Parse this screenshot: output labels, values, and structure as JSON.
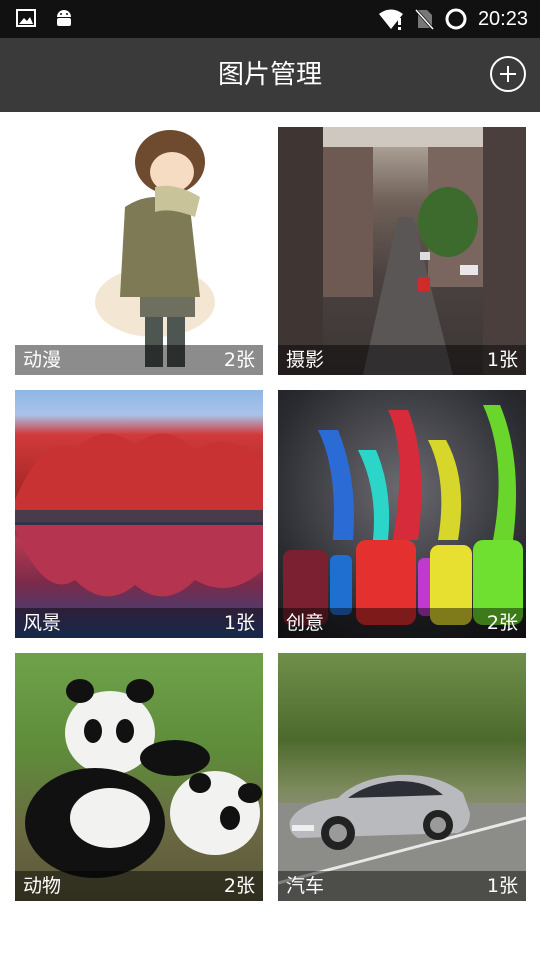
{
  "status_bar": {
    "time": "20:23",
    "icons": [
      "image-icon",
      "android-icon",
      "wifi-alert-icon",
      "no-sim-icon",
      "battery-ring-icon"
    ]
  },
  "app_bar": {
    "title": "图片管理",
    "add_icon": "plus-circle-icon"
  },
  "albums": [
    {
      "name": "动漫",
      "count": "2张",
      "thumb": "anime"
    },
    {
      "name": "摄影",
      "count": "1张",
      "thumb": "street-photo"
    },
    {
      "name": "风景",
      "count": "1张",
      "thumb": "red-forest-lake"
    },
    {
      "name": "创意",
      "count": "2张",
      "thumb": "paint-splash-bottles"
    },
    {
      "name": "动物",
      "count": "2张",
      "thumb": "pandas"
    },
    {
      "name": "汽车",
      "count": "1张",
      "thumb": "silver-sports-car"
    }
  ],
  "colors": {
    "status_bar": "#111111",
    "app_bar": "#3a3a3a",
    "caption_overlay": "rgba(0,0,0,0.45)",
    "background": "#ffffff"
  }
}
